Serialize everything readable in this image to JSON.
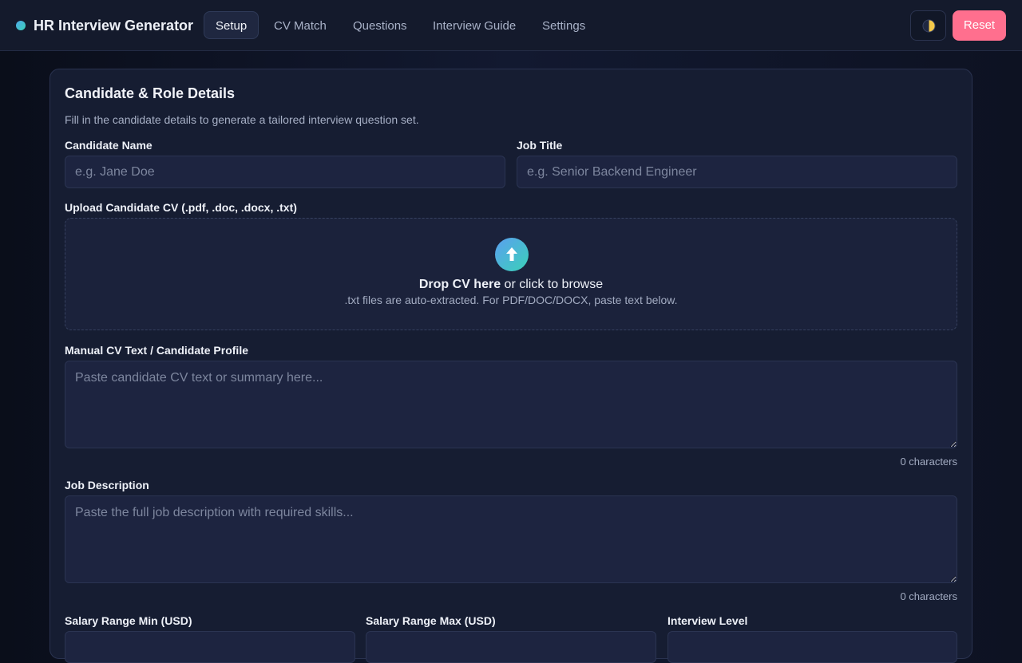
{
  "app": {
    "title": "HR Interview Generator"
  },
  "nav": {
    "tabs": [
      {
        "label": "Setup",
        "active": true
      },
      {
        "label": "CV Match",
        "active": false
      },
      {
        "label": "Questions",
        "active": false
      },
      {
        "label": "Interview Guide",
        "active": false
      },
      {
        "label": "Settings",
        "active": false
      }
    ]
  },
  "header": {
    "theme_icon": "half-moon-icon",
    "reset_label": "Reset"
  },
  "form": {
    "title": "Candidate & Role Details",
    "subtitle": "Fill in the candidate details to generate a tailored interview question set.",
    "candidate_name": {
      "label": "Candidate Name",
      "placeholder": "e.g. Jane Doe",
      "value": ""
    },
    "job_title": {
      "label": "Job Title",
      "placeholder": "e.g. Senior Backend Engineer",
      "value": ""
    },
    "upload": {
      "label": "Upload Candidate CV (.pdf, .doc, .docx, .txt)",
      "icon": "upload-arrow-icon",
      "main_bold": "Drop CV here",
      "main_rest": " or click to browse",
      "hint": ".txt files are auto-extracted. For PDF/DOC/DOCX, paste text below."
    },
    "cv_text": {
      "label": "Manual CV Text / Candidate Profile",
      "placeholder": "Paste candidate CV text or summary here...",
      "counter": "0 characters"
    },
    "job_description": {
      "label": "Job Description",
      "placeholder": "Paste the full job description with required skills...",
      "counter": "0 characters"
    },
    "salary_min": {
      "label": "Salary Range Min (USD)"
    },
    "salary_max": {
      "label": "Salary Range Max (USD)"
    },
    "interview_level": {
      "label": "Interview Level"
    }
  },
  "colors": {
    "accent": "#ff6f8e",
    "brand_gradient_start": "#4fa8e8",
    "brand_gradient_end": "#3ad1b8"
  }
}
